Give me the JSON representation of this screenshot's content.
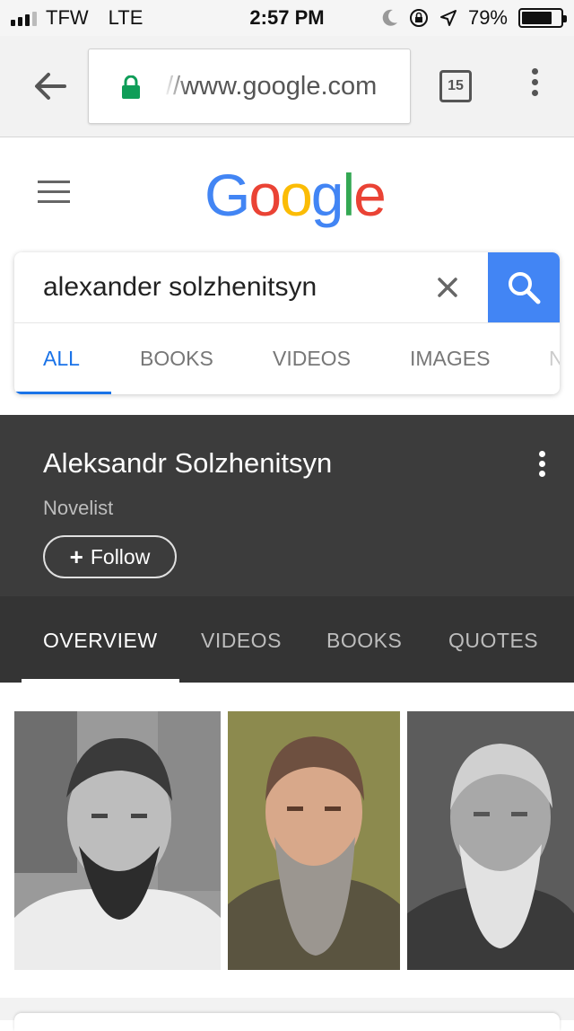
{
  "status_bar": {
    "carrier": "TFW",
    "network": "LTE",
    "time": "2:57 PM",
    "battery": "79%",
    "battery_level": 0.79,
    "icons": [
      "signal-icon",
      "moon-icon",
      "rotation-lock-icon",
      "location-arrow-icon",
      "battery-icon"
    ]
  },
  "browser": {
    "url": "//www.google.com",
    "tab_count": "15",
    "icons": [
      "back-arrow-icon",
      "lock-icon",
      "kebab-menu-icon"
    ]
  },
  "google": {
    "logo": [
      "G",
      "o",
      "o",
      "g",
      "l",
      "e"
    ],
    "colors": {
      "blue": "#4285f4",
      "red": "#ea4335",
      "yellow": "#fbbc05",
      "green": "#34a853"
    }
  },
  "search": {
    "query": "alexander solzhenitsyn",
    "tabs": [
      {
        "label": "ALL",
        "active": true
      },
      {
        "label": "BOOKS",
        "active": false
      },
      {
        "label": "VIDEOS",
        "active": false
      },
      {
        "label": "IMAGES",
        "active": false
      },
      {
        "label": "N",
        "active": false
      }
    ]
  },
  "knowledge_panel": {
    "title": "Aleksandr Solzhenitsyn",
    "subtitle": "Novelist",
    "follow_label": "Follow",
    "tabs": [
      {
        "label": "OVERVIEW",
        "active": true
      },
      {
        "label": "VIDEOS",
        "active": false
      },
      {
        "label": "BOOKS",
        "active": false
      },
      {
        "label": "QUOTES",
        "active": false
      }
    ]
  },
  "images": [
    {
      "style": "black-and-white portrait"
    },
    {
      "style": "color portrait"
    },
    {
      "style": "black-and-white portrait"
    }
  ]
}
